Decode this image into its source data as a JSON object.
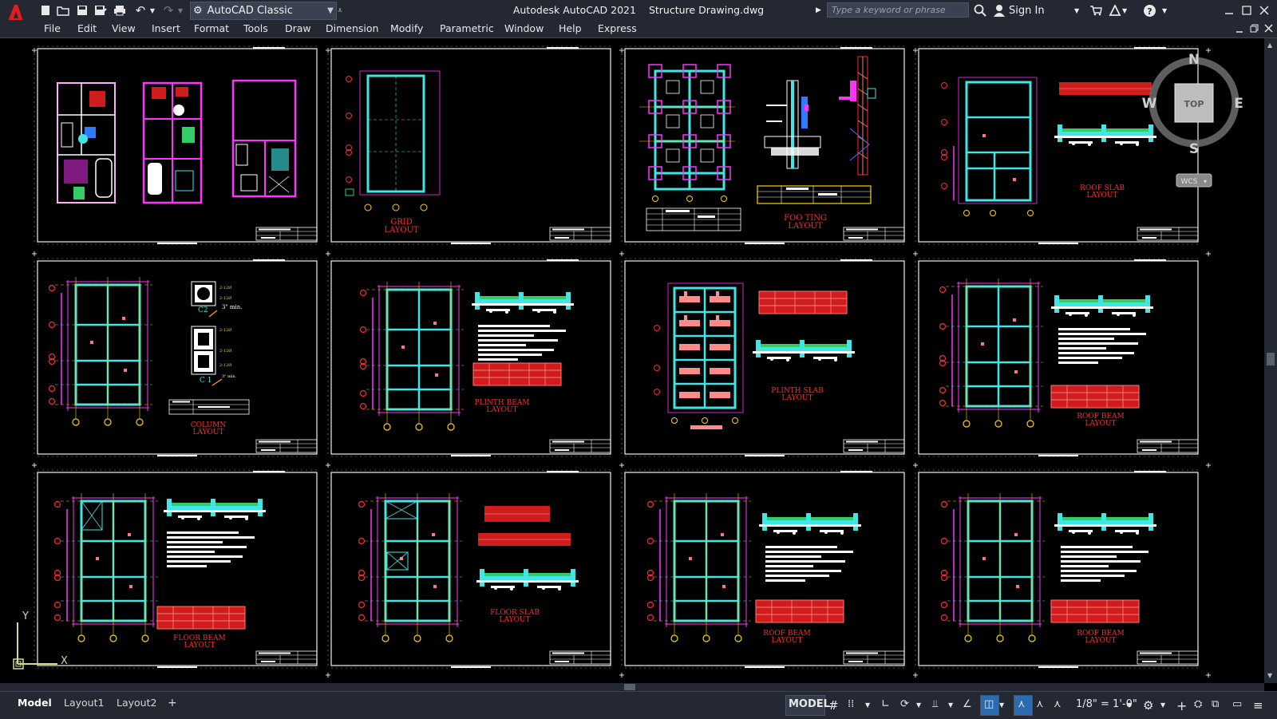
{
  "titlebar": {
    "workspace": "AutoCAD Classic",
    "app_name": "Autodesk AutoCAD 2021",
    "file_name": "Structure Drawing.dwg",
    "search_placeholder": "Type a keyword or phrase",
    "sign_in": "Sign In"
  },
  "menu": [
    "File",
    "Edit",
    "View",
    "Insert",
    "Format",
    "Tools",
    "Draw",
    "Dimension",
    "Modify",
    "Parametric",
    "Window",
    "Help",
    "Express"
  ],
  "viewcube": {
    "n": "N",
    "s": "S",
    "e": "E",
    "w": "W",
    "top": "TOP",
    "wcs": "WCS"
  },
  "ucs": {
    "x": "X",
    "y": "Y"
  },
  "sheet_labels": {
    "grid": [
      "GRID",
      "LAYOUT"
    ],
    "footing": [
      "FOO TING",
      "LAYOUT"
    ],
    "roof_slab": [
      "ROOF SLAB",
      "LAYOUT"
    ],
    "column": [
      "COLUMN",
      "LAYOUT"
    ],
    "plinth_beam": [
      "PLINTH BEAM",
      "LAYOUT"
    ],
    "plinth_slab": [
      "PLINTH SLAB",
      "LAYOUT"
    ],
    "roof_beam": [
      "ROOF BEAM",
      "LAYOUT"
    ],
    "floor_beam": [
      "FLOOR BEAM",
      "LAYOUT"
    ],
    "floor_slab": [
      "FLOOR SLAB",
      "LAYOUT"
    ],
    "c1": "C 1",
    "c2": "C2",
    "bars": "2-12Ø",
    "min": "3\" min."
  },
  "tabs": {
    "model": "Model",
    "layout1": "Layout1",
    "layout2": "Layout2",
    "add": "+"
  },
  "status": {
    "mode": "MODEL",
    "scale": "1/8\" = 1'-0\""
  },
  "colors": {
    "ui_bg": "#232832",
    "canvas": "#000000",
    "cad_red": "#ff2a2a",
    "cad_cyan": "#3ee6e6",
    "cad_magenta": "#ff33ff",
    "cad_yellow": "#ffd200",
    "cad_green": "#33cc66"
  }
}
